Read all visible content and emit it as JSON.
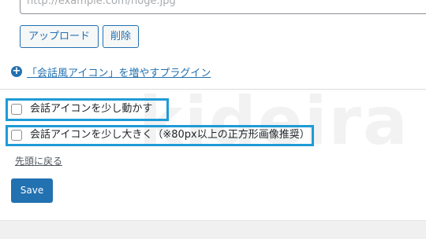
{
  "image_field": {
    "placeholder": "http://example.com/hoge.jpg"
  },
  "buttons": {
    "upload_label": "アップロード",
    "delete_label": "削除"
  },
  "plugin_link": {
    "text": "「会話風アイコン」を増やすプラグイン"
  },
  "watermark": {
    "text": "kideira"
  },
  "options": [
    {
      "label": "会話アイコンを少し動かす",
      "checked": false
    },
    {
      "label": "会話アイコンを少し大きく（※80px以上の正方形画像推奨）",
      "checked": false
    }
  ],
  "back_link": {
    "text": "先頭に戻る"
  },
  "save_button": {
    "label": "Save"
  },
  "colors": {
    "accent": "#2271b1",
    "highlight_border": "#1e9bd7",
    "text": "#1d2327"
  }
}
